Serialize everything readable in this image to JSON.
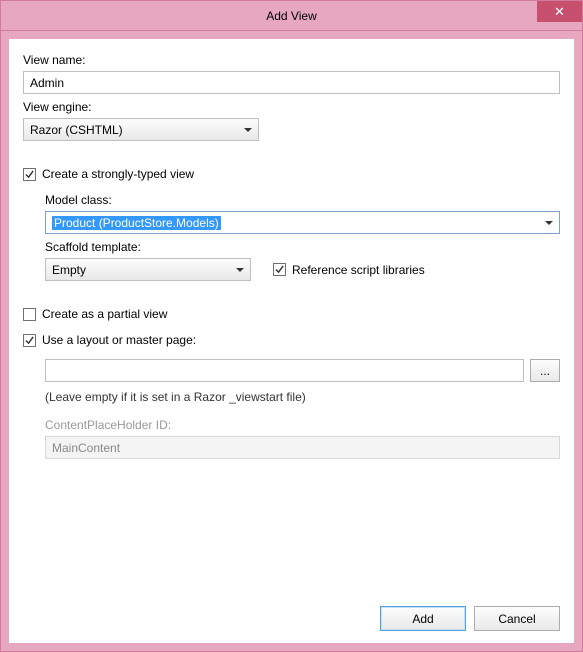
{
  "title": "Add View",
  "close_glyph": "✕",
  "labels": {
    "view_name": "View name:",
    "view_engine": "View engine:",
    "model_class": "Model class:",
    "scaffold_template": "Scaffold template:",
    "cph_id": "ContentPlaceHolder ID:"
  },
  "fields": {
    "view_name_value": "Admin",
    "view_engine_value": "Razor (CSHTML)",
    "model_class_value": "Product (ProductStore.Models)",
    "scaffold_template_value": "Empty",
    "layout_path_value": "",
    "cph_id_value": "MainContent"
  },
  "checkboxes": {
    "strongly_typed": {
      "label": "Create a strongly-typed view",
      "checked": true
    },
    "ref_scripts": {
      "label": "Reference script libraries",
      "checked": true
    },
    "partial_view": {
      "label": "Create as a partial view",
      "checked": false
    },
    "use_layout": {
      "label": "Use a layout or master page:",
      "checked": true
    }
  },
  "hints": {
    "layout_empty": "(Leave empty if it is set in a Razor _viewstart file)"
  },
  "buttons": {
    "browse": "...",
    "add": "Add",
    "cancel": "Cancel"
  }
}
